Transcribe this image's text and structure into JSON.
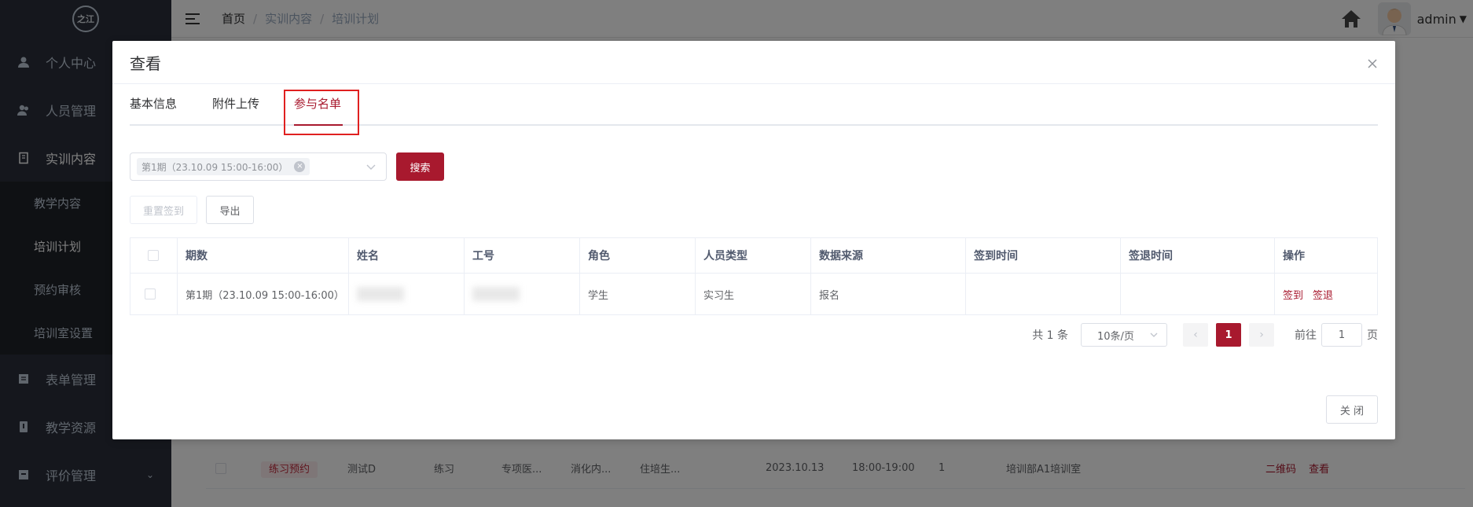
{
  "sidebar": {
    "logo_text": "之江",
    "items": [
      {
        "label": "个人中心",
        "icon": "user-icon"
      },
      {
        "label": "人员管理",
        "icon": "users-icon"
      },
      {
        "label": "实训内容",
        "icon": "book-icon"
      },
      {
        "label": "表单管理",
        "icon": "form-icon"
      },
      {
        "label": "教学资源",
        "icon": "resource-icon"
      },
      {
        "label": "评价管理",
        "icon": "evaluate-icon"
      }
    ],
    "submenu": [
      "教学内容",
      "培训计划",
      "预约审核",
      "培训室设置"
    ]
  },
  "topbar": {
    "breadcrumb": [
      "首页",
      "实训内容",
      "培训计划"
    ],
    "user": "admin"
  },
  "background_row": {
    "tag": "练习预约",
    "name": "测试D",
    "type": "练习",
    "col4": "专项医...",
    "col5": "消化内...",
    "col6": "住培生...",
    "date": "2023.10.13",
    "time": "18:00-19:00",
    "count": "1",
    "room": "培训部A1培训室",
    "actions": [
      "二维码",
      "查看"
    ]
  },
  "dialog": {
    "title": "查看",
    "tabs": [
      "基本信息",
      "附件上传",
      "参与名单"
    ],
    "active_tab": 2,
    "filter": {
      "selected_tag": "第1期（23.10.09 15:00-16:00）",
      "search_label": "搜索"
    },
    "actions": {
      "reset_label": "重置签到",
      "export_label": "导出"
    },
    "table": {
      "headers": [
        "期数",
        "姓名",
        "工号",
        "角色",
        "人员类型",
        "数据来源",
        "签到时间",
        "签退时间",
        "操作"
      ],
      "rows": [
        {
          "period": "第1期（23.10.09 15:00-16:00）",
          "name": "",
          "id": "",
          "role": "学生",
          "person_type": "实习生",
          "source": "报名",
          "checkin": "",
          "checkout": "",
          "actions": [
            "签到",
            "签退"
          ]
        }
      ]
    },
    "pagination": {
      "total_text": "共 1 条",
      "page_size": "10条/页",
      "current_page": "1",
      "goto_prefix": "前往",
      "goto_value": "1",
      "goto_suffix": "页"
    },
    "close_label": "关 闭"
  }
}
